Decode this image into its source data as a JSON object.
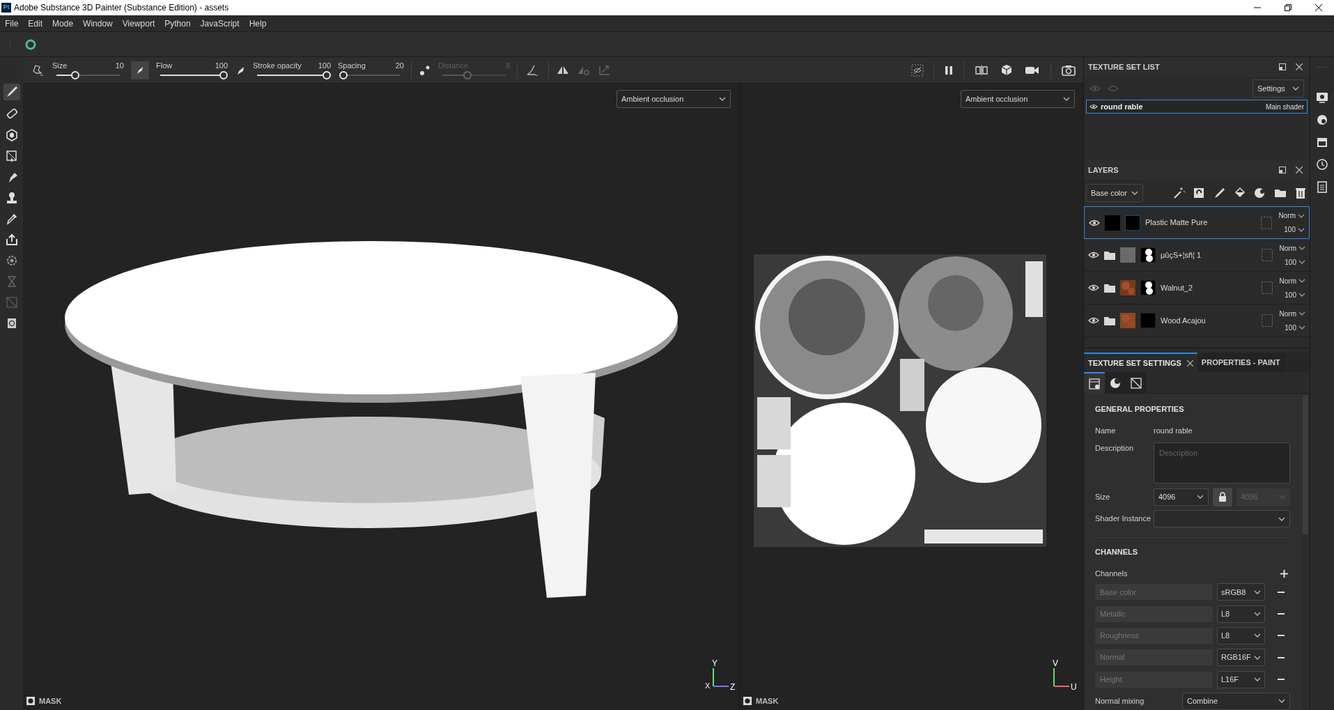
{
  "window": {
    "title": "Adobe Substance 3D Painter (Substance Edition) - assets",
    "app_badge": "Pt"
  },
  "menu": [
    "File",
    "Edit",
    "Mode",
    "Window",
    "Viewport",
    "Python",
    "JavaScript",
    "Help"
  ],
  "tool_options": [
    {
      "label": "Size",
      "value": "10",
      "level": 0.3,
      "disabled": false
    },
    {
      "label": "Flow",
      "value": "100",
      "level": 1,
      "disabled": false
    },
    {
      "label": "Stroke opacity",
      "value": "100",
      "level": 1,
      "disabled": false
    },
    {
      "label": "Spacing",
      "value": "20",
      "level": 0.02,
      "disabled": false
    },
    {
      "label": "Distance",
      "value": "8",
      "level": 0.4,
      "disabled": true
    }
  ],
  "viewports": [
    {
      "channel": "Ambient occlusion",
      "axes": [
        "Y",
        "X",
        "Z"
      ],
      "mask_label": "MASK",
      "kind": "model"
    },
    {
      "channel": "Ambient occlusion",
      "axes": [
        "V",
        "U"
      ],
      "mask_label": "MASK",
      "kind": "uv"
    }
  ],
  "texture_set_list": {
    "title": "TEXTURE SET LIST",
    "settings": "Settings",
    "items": [
      {
        "name": "round rable",
        "shader": "Main shader",
        "selected": true
      }
    ]
  },
  "layers": {
    "title": "LAYERS",
    "channel": "Base color",
    "items": [
      {
        "name": "Plastic Matte Pure",
        "kind": "fill",
        "blend": "Norm",
        "opacity": "100",
        "selected": true
      },
      {
        "name": "µûçS+¦sñ¦ 1",
        "kind": "folder",
        "blend": "Norm",
        "opacity": "100",
        "selected": false
      },
      {
        "name": "Walnut_2",
        "kind": "folder",
        "blend": "Norm",
        "opacity": "100",
        "selected": false
      },
      {
        "name": "Wood Acajou",
        "kind": "folder",
        "blend": "Norm",
        "opacity": "100",
        "selected": false
      }
    ]
  },
  "tabs": [
    {
      "label": "TEXTURE SET SETTINGS",
      "selected": true,
      "closable": true
    },
    {
      "label": "PROPERTIES - PAINT",
      "selected": false,
      "closable": false
    }
  ],
  "subtabs": [
    {
      "selected": true
    },
    {
      "selected": false
    },
    {
      "selected": false
    }
  ],
  "general_properties": {
    "title": "GENERAL PROPERTIES",
    "name_label": "Name",
    "name": "round rable",
    "description_label": "Description",
    "description_placeholder": "Description",
    "size_label": "Size",
    "size": "4096",
    "size_linked": "4096",
    "shader_label": "Shader Instance"
  },
  "channels": {
    "title": "CHANNELS",
    "label": "Channels",
    "items": [
      {
        "name": "Base color",
        "format": "sRGB8"
      },
      {
        "name": "Metallic",
        "format": "L8"
      },
      {
        "name": "Roughness",
        "format": "L8"
      },
      {
        "name": "Normal",
        "format": "RGB16F"
      },
      {
        "name": "Height",
        "format": "L16F"
      }
    ],
    "normal_mixing_label": "Normal mixing",
    "normal_mixing": "Combine"
  }
}
